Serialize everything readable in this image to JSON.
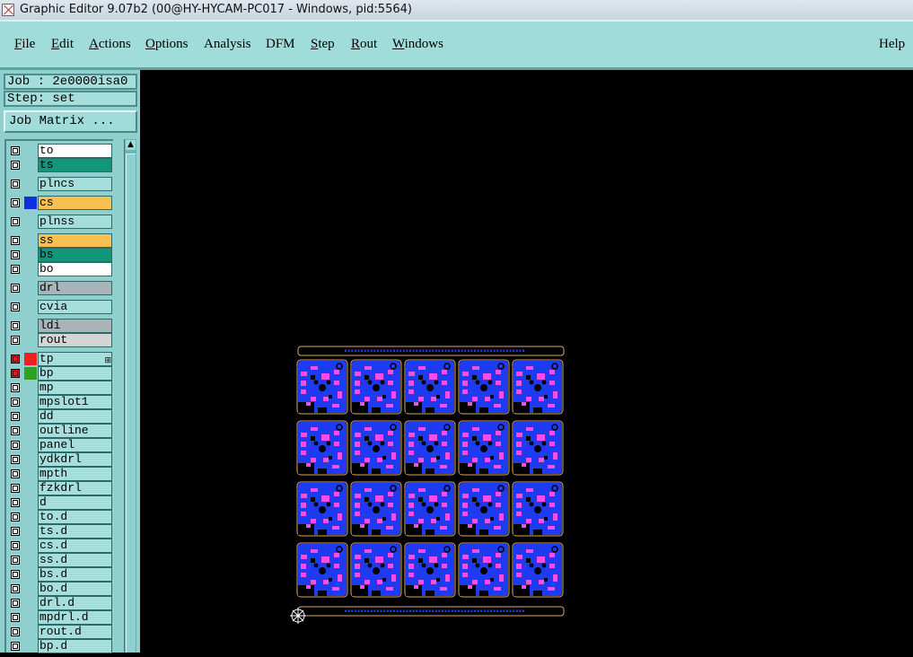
{
  "window": {
    "title": "Graphic Editor 9.07b2 (00@HY-HYCAM-PC017 - Windows, pid:5564)"
  },
  "menu": [
    {
      "label": "File",
      "ul": "F"
    },
    {
      "label": "Edit",
      "ul": "E"
    },
    {
      "label": "Actions",
      "ul": "A"
    },
    {
      "label": "Options",
      "ul": "O"
    },
    {
      "label": "Analysis",
      "ul": ""
    },
    {
      "label": "DFM",
      "ul": ""
    },
    {
      "label": "Step",
      "ul": "S"
    },
    {
      "label": "Rout",
      "ul": "R"
    },
    {
      "label": "Windows",
      "ul": "W"
    }
  ],
  "help_label": "Help",
  "job": {
    "label": "Job : 2e0000isa0",
    "step": "Step: set",
    "matrix_button": "Job Matrix ..."
  },
  "layers": [
    {
      "name": "to",
      "color": "#ffffff"
    },
    {
      "name": "ts",
      "color": "#12967a"
    },
    {
      "name": "plncs",
      "color": "#a6dedc"
    },
    {
      "name": "cs",
      "color": "#f8c052",
      "swatch": "#1030e0"
    },
    {
      "name": "plnss",
      "color": "#a6dedc"
    },
    {
      "name": "ss",
      "color": "#f8c052"
    },
    {
      "name": "bs",
      "color": "#12967a"
    },
    {
      "name": "bo",
      "color": "#ffffff"
    },
    {
      "name": "drl",
      "color": "#a8b4b8"
    },
    {
      "name": "cvia",
      "color": "#a6dedc"
    },
    {
      "name": "ldi",
      "color": "#a8b4b8"
    },
    {
      "name": "rout",
      "color": "#d4d4d4"
    },
    {
      "name": "tp",
      "color": "#a6dedc",
      "swatch": "#f02020",
      "active": true,
      "mark": "⊞"
    },
    {
      "name": "bp",
      "color": "#a6dedc",
      "swatch": "#30a020",
      "active": true
    },
    {
      "name": "mp",
      "color": "#a6dedc"
    },
    {
      "name": "mpslot1",
      "color": "#a6dedc"
    },
    {
      "name": "dd",
      "color": "#a6dedc"
    },
    {
      "name": "outline",
      "color": "#a6dedc"
    },
    {
      "name": "panel",
      "color": "#a6dedc"
    },
    {
      "name": "ydkdrl",
      "color": "#a6dedc"
    },
    {
      "name": "mpth",
      "color": "#a6dedc"
    },
    {
      "name": "fzkdrl",
      "color": "#a6dedc"
    },
    {
      "name": "d",
      "color": "#a6dedc"
    },
    {
      "name": "to.d",
      "color": "#a6dedc"
    },
    {
      "name": "ts.d",
      "color": "#a6dedc"
    },
    {
      "name": "cs.d",
      "color": "#a6dedc"
    },
    {
      "name": "ss.d",
      "color": "#a6dedc"
    },
    {
      "name": "bs.d",
      "color": "#a6dedc"
    },
    {
      "name": "bo.d",
      "color": "#a6dedc"
    },
    {
      "name": "drl.d",
      "color": "#a6dedc"
    },
    {
      "name": "mpdrl.d",
      "color": "#a6dedc"
    },
    {
      "name": "rout.d",
      "color": "#a6dedc"
    },
    {
      "name": "bp.d",
      "color": "#a6dedc"
    }
  ],
  "panel_array": {
    "columns": 5,
    "rows": 4
  },
  "colors": {
    "board": "#1f3bf2",
    "pad": "#f44ee6",
    "outline": "#d8a860",
    "menu_bg": "#9fdcda"
  },
  "icons": {
    "origin": "crosshair-icon",
    "app": "app-icon"
  }
}
